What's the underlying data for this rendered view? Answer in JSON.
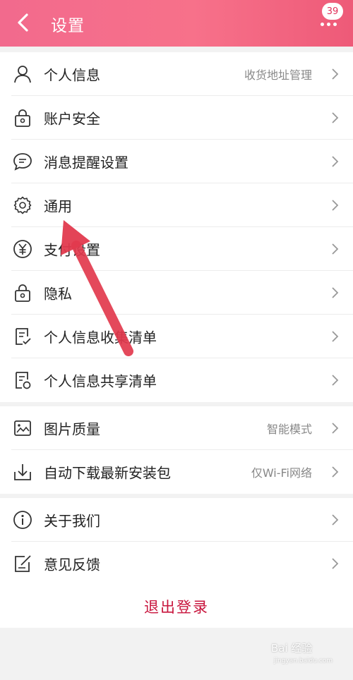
{
  "header": {
    "title": "设置",
    "badge_count": "39"
  },
  "groups": [
    {
      "items": [
        {
          "label": "个人信息",
          "value": "收货地址管理",
          "icon": "user-icon"
        },
        {
          "label": "账户安全",
          "value": "",
          "icon": "lock-icon"
        },
        {
          "label": "消息提醒设置",
          "value": "",
          "icon": "chat-bubble-icon"
        },
        {
          "label": "通用",
          "value": "",
          "icon": "gear-icon"
        },
        {
          "label": "支付设置",
          "value": "",
          "icon": "yen-icon"
        },
        {
          "label": "隐私",
          "value": "",
          "icon": "lock-icon"
        },
        {
          "label": "个人信息收集清单",
          "value": "",
          "icon": "checklist-icon"
        },
        {
          "label": "个人信息共享清单",
          "value": "",
          "icon": "share-list-icon"
        }
      ]
    },
    {
      "items": [
        {
          "label": "图片质量",
          "value": "智能模式",
          "icon": "image-icon"
        },
        {
          "label": "自动下载最新安装包",
          "value": "仅Wi-Fi网络",
          "icon": "download-icon"
        }
      ]
    },
    {
      "items": [
        {
          "label": "关于我们",
          "value": "",
          "icon": "info-icon"
        },
        {
          "label": "意见反馈",
          "value": "",
          "icon": "edit-icon"
        }
      ]
    }
  ],
  "logout_label": "退出登录",
  "watermark": {
    "text": "Bai 经验",
    "url": "jingyan.baidu.com"
  },
  "colors": {
    "header_start": "#f26a8d",
    "header_end": "#ee5a78",
    "logout_text": "#c8143c",
    "annotation_arrow": "#e23a4e"
  }
}
